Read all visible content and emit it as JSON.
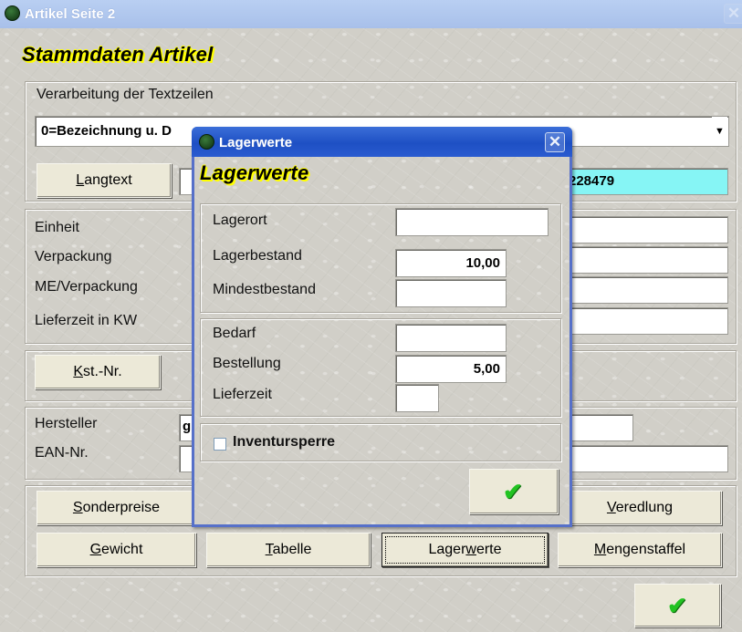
{
  "window": {
    "title": "Artikel Seite 2",
    "heading": "Stammdaten Artikel",
    "close_glyph": "✕",
    "text_processing_label": "Verarbeitung der Textzeilen",
    "text_processing_value": "0=Bezeichnung u. D",
    "langtext_button": {
      "pre": "",
      "key": "L",
      "post": "angtext"
    },
    "article_code_value": "228479",
    "unit_labels": [
      "Einheit",
      "Verpackung",
      "ME/Verpackung",
      "Lieferzeit in KW"
    ],
    "kst_button": {
      "pre": "",
      "key": "K",
      "post": "st.-Nr."
    },
    "hersteller_label": "Hersteller",
    "hersteller_value": "g",
    "ean_label": "EAN-Nr.",
    "buttons_row1": {
      "sonderpreise": {
        "pre": "",
        "key": "S",
        "post": "onderpreise"
      },
      "veredlung": {
        "pre": "",
        "key": "V",
        "post": "eredlung"
      }
    },
    "buttons_row2": {
      "gewicht": {
        "pre": "",
        "key": "G",
        "post": "ewicht"
      },
      "tabelle": {
        "pre": "",
        "key": "T",
        "post": "abelle"
      },
      "lagerwerte": {
        "pre": "Lager",
        "key": "w",
        "post": "erte"
      },
      "mengenstaffel": {
        "pre": "",
        "key": "M",
        "post": "engenstaffel"
      }
    },
    "ok_icon": "checkmark-icon"
  },
  "dialog": {
    "title": "Lagerwerte",
    "heading": "Lagerwerte",
    "close_glyph": "✕",
    "lagerort_label": "Lagerort",
    "lagerort_value": "",
    "lagerbestand_label": "Lagerbestand",
    "lagerbestand_value": "10,00",
    "mindestbestand_label": "Mindestbestand",
    "mindestbestand_value": "",
    "bedarf_label": "Bedarf",
    "bedarf_value": "",
    "bestellung_label": "Bestellung",
    "bestellung_value": "5,00",
    "lieferzeit_label": "Lieferzeit",
    "lieferzeit_value": "",
    "inventursperre_label": "Inventursperre",
    "inventursperre_checked": false
  },
  "colors": {
    "accent_cyan": "#86f5f5",
    "title_active": "#1e50c4",
    "title_inactive": "#a8c0ea",
    "heading_highlight": "#ffff00",
    "check_green": "#22c322"
  }
}
